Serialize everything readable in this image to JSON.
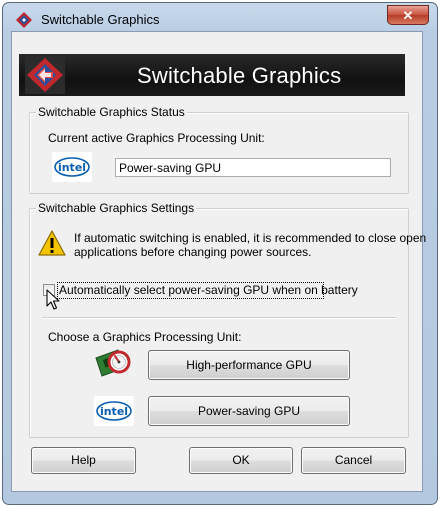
{
  "window": {
    "title": "Switchable Graphics",
    "close_label": "✕"
  },
  "banner": {
    "title": "Switchable Graphics"
  },
  "status_group": {
    "legend": "Switchable Graphics Status",
    "current_label": "Current active Graphics Processing Unit:",
    "current_value": "Power-saving GPU",
    "intel_logo_text": "intel"
  },
  "settings_group": {
    "legend": "Switchable Graphics Settings",
    "warning_line1": "If automatic switching is enabled, it is recommended to close open",
    "warning_line2": "applications before changing power sources.",
    "auto_select_label": "Automatically select power-saving GPU when on battery",
    "auto_select_checked": false,
    "choose_label": "Choose a Graphics Processing Unit:",
    "high_perf_button": "High-performance GPU",
    "power_saving_button": "Power-saving GPU",
    "intel_logo_text": "intel"
  },
  "footer": {
    "help": "Help",
    "ok": "OK",
    "cancel": "Cancel"
  },
  "colors": {
    "banner_bg": "#111111",
    "intel_blue": "#0a5eb0",
    "warning_yellow": "#f5c400",
    "close_red": "#c9523f"
  }
}
